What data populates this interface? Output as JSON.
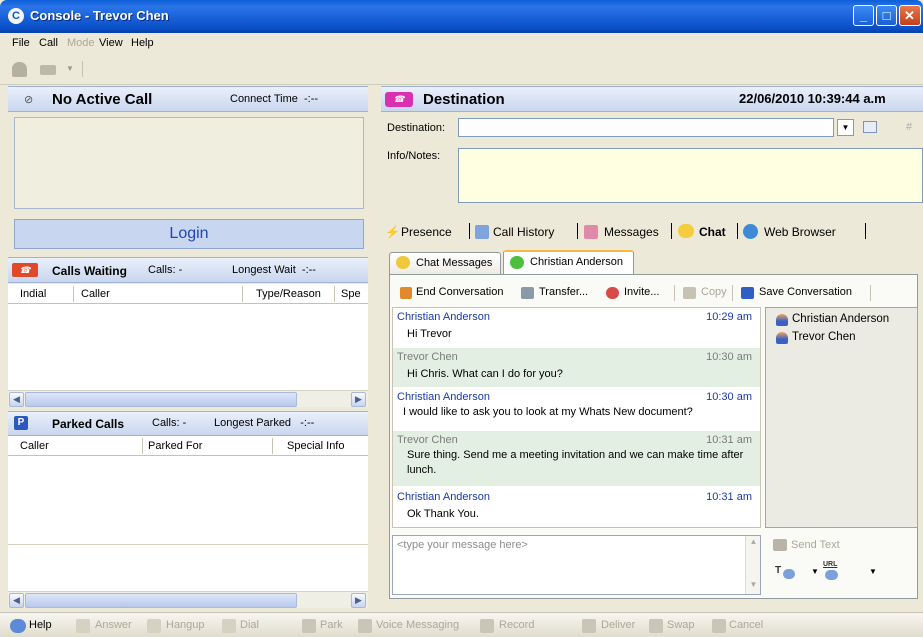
{
  "window": {
    "title": "Console - Trevor Chen",
    "app_icon_letter": "C"
  },
  "menu": [
    {
      "label": "File",
      "disabled": false
    },
    {
      "label": "Call",
      "disabled": false
    },
    {
      "label": "Mode",
      "disabled": true
    },
    {
      "label": "View",
      "disabled": false
    },
    {
      "label": "Help",
      "disabled": false
    }
  ],
  "call_panel": {
    "title": "No Active Call",
    "connect_label": "Connect Time",
    "connect_value": "-:--",
    "login_label": "Login"
  },
  "calls_waiting": {
    "title": "Calls Waiting",
    "calls_label": "Calls:",
    "calls_value": "-",
    "longest_label": "Longest Wait",
    "longest_value": "-:--",
    "columns": [
      "Indial",
      "Caller",
      "Type/Reason",
      "Spe"
    ]
  },
  "parked": {
    "title": "Parked Calls",
    "calls_label": "Calls:",
    "calls_value": "-",
    "longest_label": "Longest Parked",
    "longest_value": "-:--",
    "columns": [
      "Caller",
      "Parked For",
      "Special Info"
    ],
    "icon_letter": "P"
  },
  "destination": {
    "title": "Destination",
    "datetime": "22/06/2010 10:39:44 a.m",
    "destination_label": "Destination:",
    "destination_value": "",
    "notes_label": "Info/Notes:",
    "hash": "#"
  },
  "tabs": [
    {
      "label": "Presence",
      "active": false
    },
    {
      "label": "Call History",
      "active": false
    },
    {
      "label": "Messages",
      "active": false
    },
    {
      "label": "Chat",
      "active": true
    },
    {
      "label": "Web Browser",
      "active": false
    }
  ],
  "subtabs": [
    {
      "label": "Chat Messages",
      "active": false
    },
    {
      "label": "Christian Anderson",
      "active": true
    }
  ],
  "chat_tools": [
    {
      "label": "End Conversation",
      "disabled": false
    },
    {
      "label": "Transfer...",
      "disabled": false
    },
    {
      "label": "Invite...",
      "disabled": false
    },
    {
      "label": "Copy",
      "disabled": true
    },
    {
      "label": "Save Conversation",
      "disabled": false
    }
  ],
  "messages": [
    {
      "from": "Christian Anderson",
      "time": "10:29 am",
      "text": "Hi Trevor",
      "me": false
    },
    {
      "from": "Trevor Chen",
      "time": "10:30 am",
      "text": "Hi Chris. What can I do for you?",
      "me": true
    },
    {
      "from": "Christian Anderson",
      "time": "10:30 am",
      "text": "I would like to ask you to look at my Whats New document?",
      "me": false
    },
    {
      "from": "Trevor Chen",
      "time": "10:31 am",
      "text": "Sure thing. Send me a meeting invitation and we can make time after lunch.",
      "me": true
    },
    {
      "from": "Christian Anderson",
      "time": "10:31 am",
      "text": "Ok Thank You.",
      "me": false
    }
  ],
  "participants": [
    "Christian Anderson",
    "Trevor Chen"
  ],
  "compose": {
    "placeholder": "<type your message here>",
    "send_label": "Send Text"
  },
  "statusbar": [
    {
      "label": "Help",
      "disabled": false
    },
    {
      "label": "Answer",
      "disabled": true
    },
    {
      "label": "Hangup",
      "disabled": true
    },
    {
      "label": "Dial",
      "disabled": true
    },
    {
      "label": "Park",
      "disabled": true
    },
    {
      "label": "Voice Messaging",
      "disabled": true
    },
    {
      "label": "Record",
      "disabled": true
    },
    {
      "label": "Deliver",
      "disabled": true
    },
    {
      "label": "Swap",
      "disabled": true
    },
    {
      "label": "Cancel",
      "disabled": true
    }
  ],
  "colors": {
    "accent": "#0a5fd8",
    "link_blue": "#1a3aa8",
    "chat_highlight": "#e4efe4"
  }
}
